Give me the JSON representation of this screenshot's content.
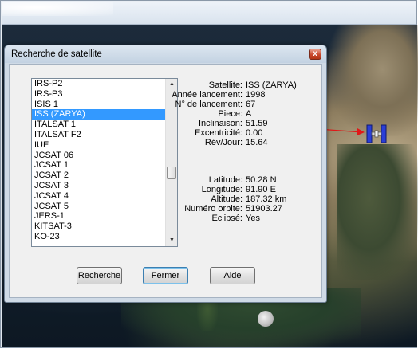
{
  "dialog": {
    "title": "Recherche de satellite",
    "close_label": "x"
  },
  "satellite_list": {
    "items": [
      "IRS-P2",
      "IRS-P3",
      "ISIS 1",
      "ISS (ZARYA)",
      "ITALSAT 1",
      "ITALSAT F2",
      "IUE",
      "JCSAT 06",
      "JCSAT 1",
      "JCSAT 2",
      "JCSAT 3",
      "JCSAT 4",
      "JCSAT 5",
      "JERS-1",
      "KITSAT-3",
      "KO-23"
    ],
    "selected_index": 3
  },
  "info": {
    "satellite_label": "Satellite:",
    "satellite_value": "ISS (ZARYA)",
    "annee_label": "Année lancement:",
    "annee_value": "1998",
    "numero_label": "N° de lancement:",
    "numero_value": "67",
    "piece_label": "Piece:",
    "piece_value": "A",
    "inclinaison_label": "Inclinaison:",
    "inclinaison_value": "51.59",
    "excentricite_label": "Excentricité:",
    "excentricite_value": "0.00",
    "rev_label": "Rév/Jour:",
    "rev_value": "15.64",
    "latitude_label": "Latitude:",
    "latitude_value": "50.28 N",
    "longitude_label": "Longitude:",
    "longitude_value": "91.90 E",
    "altitude_label": "Altitude:",
    "altitude_value": "187.32 km",
    "orbite_label": "Numéro orbite:",
    "orbite_value": "51903.27",
    "eclipse_label": "Eclipsé:",
    "eclipse_value": "Yes"
  },
  "buttons": {
    "search": "Recherche",
    "close": "Fermer",
    "help": "Aide"
  },
  "colors": {
    "selection": "#3399ff",
    "pointer_line": "#e01818",
    "satellite_body": "#2233cc"
  }
}
